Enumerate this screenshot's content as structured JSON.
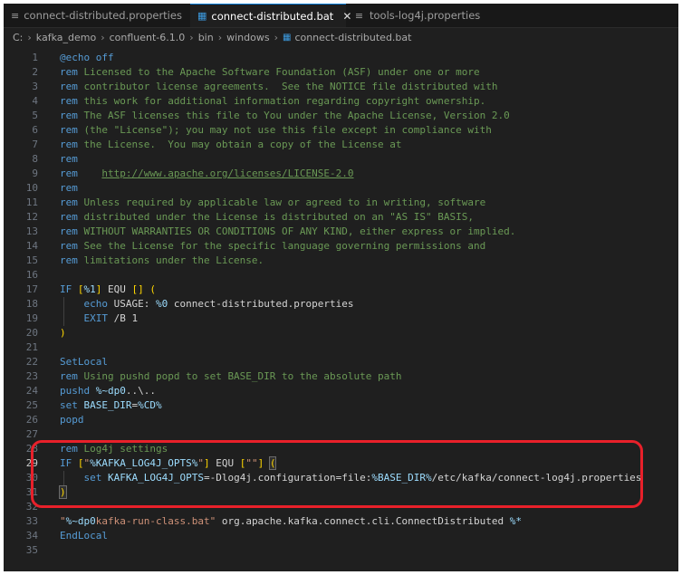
{
  "tabs": [
    {
      "label": "connect-distributed.properties",
      "icon": "properties-file-icon",
      "active": false
    },
    {
      "label": "connect-distributed.bat",
      "icon": "windows-batch-icon",
      "active": true,
      "close": "✕"
    },
    {
      "label": "tools-log4j.properties",
      "icon": "properties-file-icon",
      "active": false
    }
  ],
  "breadcrumb": {
    "items": [
      "C:",
      "kafka_demo",
      "confluent-6.1.0",
      "bin",
      "windows",
      "connect-distributed.bat"
    ],
    "separator": "›"
  },
  "editor": {
    "current_line": 29,
    "lines": [
      {
        "n": "1",
        "tokens": [
          [
            "kw",
            "@echo off"
          ]
        ]
      },
      {
        "n": "2",
        "tokens": [
          [
            "kw",
            "rem"
          ],
          [
            "cm",
            " Licensed to the Apache Software Foundation (ASF) under one or more"
          ]
        ]
      },
      {
        "n": "3",
        "tokens": [
          [
            "kw",
            "rem"
          ],
          [
            "cm",
            " contributor license agreements.  See the NOTICE file distributed with"
          ]
        ]
      },
      {
        "n": "4",
        "tokens": [
          [
            "kw",
            "rem"
          ],
          [
            "cm",
            " this work for additional information regarding copyright ownership."
          ]
        ]
      },
      {
        "n": "5",
        "tokens": [
          [
            "kw",
            "rem"
          ],
          [
            "cm",
            " The ASF licenses this file to You under the Apache License, Version 2.0"
          ]
        ]
      },
      {
        "n": "6",
        "tokens": [
          [
            "kw",
            "rem"
          ],
          [
            "cm",
            " (the \"License\"); you may not use this file except in compliance with"
          ]
        ]
      },
      {
        "n": "7",
        "tokens": [
          [
            "kw",
            "rem"
          ],
          [
            "cm",
            " the License.  You may obtain a copy of the License at"
          ]
        ]
      },
      {
        "n": "8",
        "tokens": [
          [
            "kw",
            "rem"
          ]
        ]
      },
      {
        "n": "9",
        "tokens": [
          [
            "kw",
            "rem"
          ],
          [
            "cm",
            "    "
          ],
          [
            "link",
            "http://www.apache.org/licenses/LICENSE-2.0"
          ]
        ]
      },
      {
        "n": "10",
        "tokens": [
          [
            "kw",
            "rem"
          ]
        ]
      },
      {
        "n": "11",
        "tokens": [
          [
            "kw",
            "rem"
          ],
          [
            "cm",
            " Unless required by applicable law or agreed to in writing, software"
          ]
        ]
      },
      {
        "n": "12",
        "tokens": [
          [
            "kw",
            "rem"
          ],
          [
            "cm",
            " distributed under the License is distributed on an \"AS IS\" BASIS,"
          ]
        ]
      },
      {
        "n": "13",
        "tokens": [
          [
            "kw",
            "rem"
          ],
          [
            "cm",
            " WITHOUT WARRANTIES OR CONDITIONS OF ANY KIND, either express or implied."
          ]
        ]
      },
      {
        "n": "14",
        "tokens": [
          [
            "kw",
            "rem"
          ],
          [
            "cm",
            " See the License for the specific language governing permissions and"
          ]
        ]
      },
      {
        "n": "15",
        "tokens": [
          [
            "kw",
            "rem"
          ],
          [
            "cm",
            " limitations under the License."
          ]
        ]
      },
      {
        "n": "16",
        "tokens": []
      },
      {
        "n": "17",
        "tokens": [
          [
            "kw",
            "IF"
          ],
          [
            "tx",
            " "
          ],
          [
            "br2",
            "["
          ],
          [
            "var",
            "%1"
          ],
          [
            "br2",
            "]"
          ],
          [
            "tx",
            " EQU "
          ],
          [
            "br2",
            "[]"
          ],
          [
            "tx",
            " "
          ],
          [
            "br2",
            "("
          ]
        ]
      },
      {
        "n": "18",
        "tokens": [
          [
            "tx",
            "    "
          ],
          [
            "kw",
            "echo"
          ],
          [
            "tx",
            " USAGE: "
          ],
          [
            "var",
            "%0"
          ],
          [
            "tx",
            " connect-distributed.properties"
          ]
        ]
      },
      {
        "n": "19",
        "tokens": [
          [
            "tx",
            "    "
          ],
          [
            "kw",
            "EXIT"
          ],
          [
            "tx",
            " /B 1"
          ]
        ]
      },
      {
        "n": "20",
        "tokens": [
          [
            "br2",
            ")"
          ]
        ]
      },
      {
        "n": "21",
        "tokens": []
      },
      {
        "n": "22",
        "tokens": [
          [
            "kw",
            "SetLocal"
          ]
        ]
      },
      {
        "n": "23",
        "tokens": [
          [
            "kw",
            "rem"
          ],
          [
            "cm",
            " Using pushd popd to set BASE_DIR to the absolute path"
          ]
        ]
      },
      {
        "n": "24",
        "tokens": [
          [
            "kw",
            "pushd"
          ],
          [
            "tx",
            " "
          ],
          [
            "var",
            "%~dp0"
          ],
          [
            "tx",
            "..\\.."
          ]
        ]
      },
      {
        "n": "25",
        "tokens": [
          [
            "kw",
            "set"
          ],
          [
            "tx",
            " "
          ],
          [
            "var",
            "BASE_DIR"
          ],
          [
            "tx",
            "="
          ],
          [
            "var",
            "%CD%"
          ]
        ]
      },
      {
        "n": "26",
        "tokens": [
          [
            "kw",
            "popd"
          ]
        ]
      },
      {
        "n": "27",
        "tokens": []
      },
      {
        "n": "28",
        "tokens": [
          [
            "kw",
            "rem"
          ],
          [
            "cm",
            " Log4j settings"
          ]
        ]
      },
      {
        "n": "29",
        "tokens": [
          [
            "kw",
            "IF"
          ],
          [
            "tx",
            " "
          ],
          [
            "br2",
            "["
          ],
          [
            "str",
            "\""
          ],
          [
            "var",
            "%KAFKA_LOG4J_OPTS%"
          ],
          [
            "str",
            "\""
          ],
          [
            "br2",
            "]"
          ],
          [
            "tx",
            " EQU "
          ],
          [
            "br2",
            "["
          ],
          [
            "str",
            "\"\""
          ],
          [
            "br2",
            "]"
          ],
          [
            "tx",
            " "
          ],
          [
            "hlbr",
            "("
          ]
        ]
      },
      {
        "n": "30",
        "tokens": [
          [
            "tx",
            "    "
          ],
          [
            "kw",
            "set"
          ],
          [
            "tx",
            " "
          ],
          [
            "var",
            "KAFKA_LOG4J_OPTS"
          ],
          [
            "tx",
            "=-Dlog4j.configuration=file:"
          ],
          [
            "var",
            "%BASE_DIR%"
          ],
          [
            "tx",
            "/etc/kafka/connect-log4j.properties"
          ]
        ]
      },
      {
        "n": "31",
        "tokens": [
          [
            "hlbr",
            ")"
          ]
        ]
      },
      {
        "n": "32",
        "tokens": []
      },
      {
        "n": "33",
        "tokens": [
          [
            "str",
            "\""
          ],
          [
            "var",
            "%~dp0"
          ],
          [
            "str",
            "kafka-run-class.bat\""
          ],
          [
            "tx",
            " org.apache.kafka.connect.cli.ConnectDistributed "
          ],
          [
            "var",
            "%*"
          ]
        ]
      },
      {
        "n": "34",
        "tokens": [
          [
            "kw",
            "EndLocal"
          ]
        ]
      },
      {
        "n": "35",
        "tokens": []
      }
    ]
  },
  "colors": {
    "annotation_ring": "#e8202a",
    "accent": "#0078d4"
  }
}
